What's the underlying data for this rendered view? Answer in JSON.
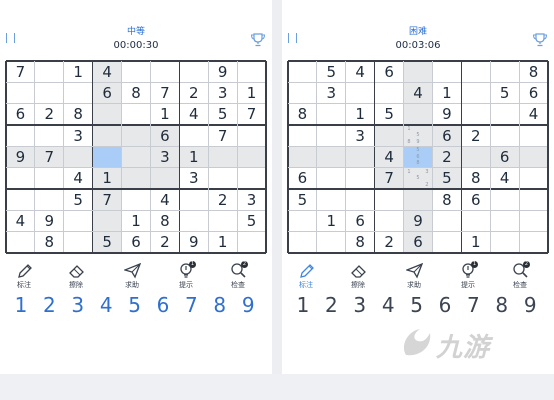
{
  "panels": [
    {
      "difficulty": "中等",
      "timer": "00:00:30",
      "selected": [
        4,
        3
      ],
      "cells": [
        [
          "7",
          "",
          "1",
          "4",
          "",
          "",
          "",
          "9",
          ""
        ],
        [
          "",
          "",
          "",
          "6",
          "8",
          "7",
          "2",
          "3",
          "1"
        ],
        [
          "6",
          "2",
          "8",
          "",
          "",
          "1",
          "4",
          "5",
          "7"
        ],
        [
          "",
          "",
          "3",
          "",
          "",
          "6",
          "",
          "7",
          ""
        ],
        [
          "9",
          "7",
          "",
          "",
          "",
          "3",
          "1",
          "",
          ""
        ],
        [
          "",
          "",
          "4",
          "1",
          "",
          "",
          "3",
          "",
          ""
        ],
        [
          "",
          "",
          "5",
          "7",
          "",
          "4",
          "",
          "2",
          "3"
        ],
        [
          "4",
          "9",
          "",
          "",
          "1",
          "8",
          "",
          "",
          "5"
        ],
        [
          "",
          "8",
          "",
          "5",
          "6",
          "2",
          "9",
          "1",
          ""
        ]
      ],
      "notes": {},
      "tools": [
        {
          "label": "标注",
          "icon": "pencil-icon",
          "badge": ""
        },
        {
          "label": "擦除",
          "icon": "eraser-icon",
          "badge": ""
        },
        {
          "label": "求助",
          "icon": "paper-plane-icon",
          "badge": ""
        },
        {
          "label": "提示",
          "icon": "lightbulb-icon",
          "badge": "1"
        },
        {
          "label": "检查",
          "icon": "search-check-icon",
          "badge": "2"
        }
      ],
      "active_tool": -1,
      "numbers": [
        "1",
        "2",
        "3",
        "4",
        "5",
        "6",
        "7",
        "8",
        "9"
      ]
    },
    {
      "difficulty": "困难",
      "timer": "00:03:06",
      "selected": [
        4,
        4
      ],
      "cells": [
        [
          "",
          "5",
          "4",
          "6",
          "",
          "",
          "",
          "",
          "8"
        ],
        [
          "",
          "3",
          "",
          "",
          "4",
          "1",
          "",
          "5",
          "6"
        ],
        [
          "8",
          "",
          "1",
          "5",
          "",
          "9",
          "",
          "",
          "4"
        ],
        [
          "",
          "",
          "3",
          "",
          "",
          "6",
          "2",
          "",
          ""
        ],
        [
          "",
          "",
          "",
          "4",
          "",
          "2",
          "",
          "6",
          ""
        ],
        [
          "6",
          "",
          "",
          "7",
          "",
          "5",
          "8",
          "4",
          ""
        ],
        [
          "5",
          "",
          "",
          "",
          "",
          "8",
          "6",
          "",
          ""
        ],
        [
          "",
          "1",
          "6",
          "",
          "9",
          "",
          "",
          "",
          ""
        ],
        [
          "",
          "",
          "8",
          "2",
          "6",
          "",
          "1",
          "",
          ""
        ]
      ],
      "notes": {
        "3-4": [
          "1",
          "",
          "",
          "",
          "5",
          "",
          "8",
          "9",
          ""
        ],
        "4-4": [
          "",
          "5",
          "",
          "",
          "6",
          "",
          "",
          "8",
          ""
        ],
        "5-4": [
          "1",
          "",
          "3",
          "",
          "5",
          "",
          "",
          "",
          "2"
        ]
      },
      "tools": [
        {
          "label": "标注",
          "icon": "pencil-icon",
          "badge": ""
        },
        {
          "label": "擦除",
          "icon": "eraser-icon",
          "badge": ""
        },
        {
          "label": "求助",
          "icon": "paper-plane-icon",
          "badge": ""
        },
        {
          "label": "提示",
          "icon": "lightbulb-icon",
          "badge": "1"
        },
        {
          "label": "检查",
          "icon": "search-check-icon",
          "badge": "2"
        }
      ],
      "active_tool": 0,
      "numbers": [
        "1",
        "2",
        "3",
        "4",
        "5",
        "6",
        "7",
        "8",
        "9"
      ]
    }
  ],
  "watermark": "九游",
  "colors": {
    "accent": "#2f6fcf",
    "highlight": "#e7e8ea",
    "selected": "#a9cdf7",
    "grid_bold": "#3a3f47",
    "grid_thin": "#c8ccd2"
  }
}
